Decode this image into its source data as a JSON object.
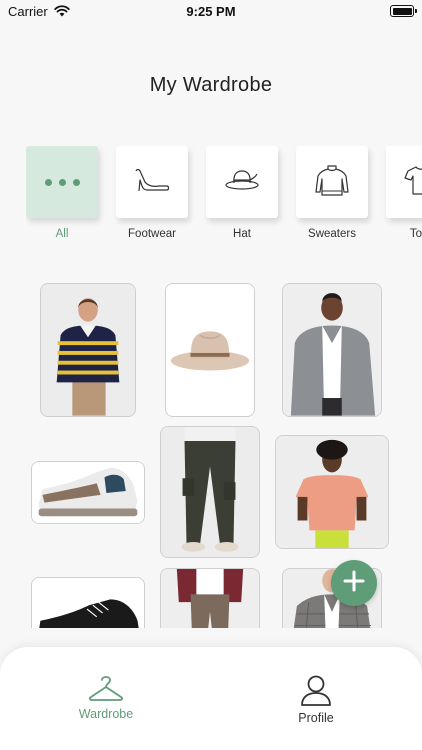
{
  "status_bar": {
    "carrier": "Carrier",
    "time": "9:25 PM"
  },
  "header": {
    "title": "My Wardrobe"
  },
  "categories": [
    {
      "label": "All",
      "icon": "more-dots-icon",
      "active": true
    },
    {
      "label": "Footwear",
      "icon": "high-heel-icon",
      "active": false
    },
    {
      "label": "Hat",
      "icon": "hat-icon",
      "active": false
    },
    {
      "label": "Sweaters",
      "icon": "sweater-icon",
      "active": false
    },
    {
      "label": "Tops",
      "icon": "tshirt-icon",
      "active": false
    }
  ],
  "wardrobe_items": [
    "striped-rugby-shirt",
    "beige-fedora-hat",
    "grey-blazer",
    "sneakers",
    "olive-cargo-pants",
    "pink-tshirt",
    "black-sneakers",
    "brown-trousers",
    "plaid-blazer"
  ],
  "tab_bar": {
    "wardrobe_label": "Wardrobe",
    "profile_label": "Profile"
  },
  "colors": {
    "accent": "#5f9c78",
    "accent_light": "#d6e9de",
    "background": "#f7f7f7"
  }
}
